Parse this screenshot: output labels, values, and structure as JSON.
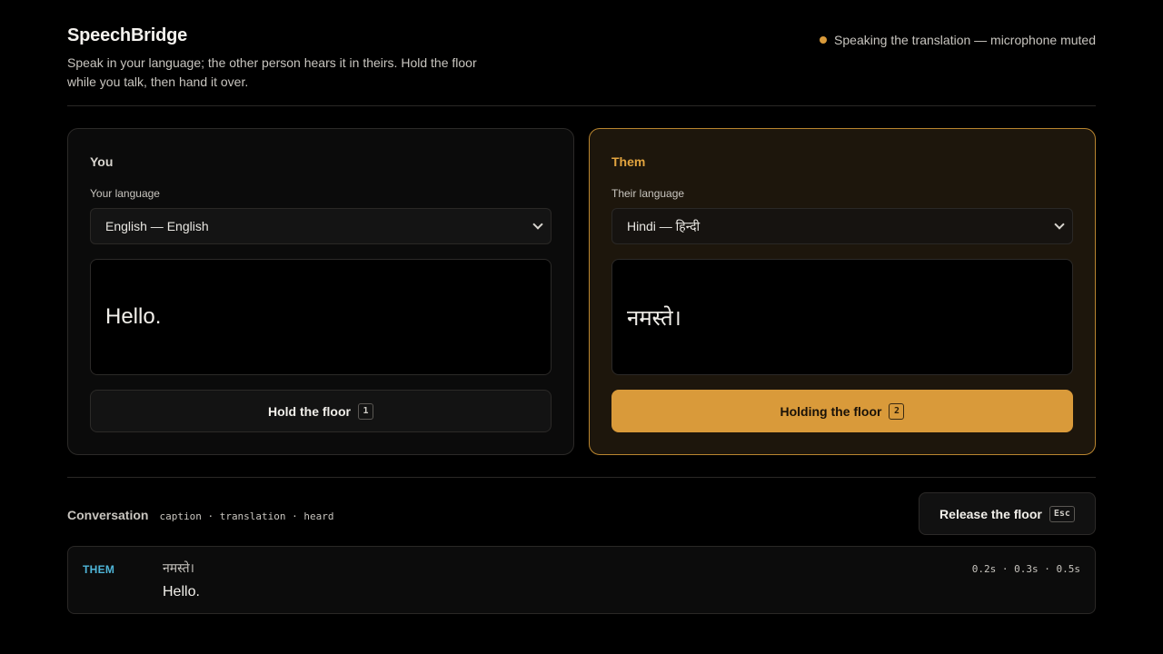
{
  "app": {
    "title": "SpeechBridge",
    "subtitle": "Speak in your language; the other person hears it in theirs. Hold the floor while you talk, then hand it over.",
    "status": "Speaking the translation — microphone muted",
    "status_color": "#d99a3a"
  },
  "you": {
    "label": "You",
    "language_label": "Your language",
    "language_value": "English — English",
    "caption": "Hello.",
    "button_label": "Hold the floor",
    "button_key": "1"
  },
  "them": {
    "label": "Them",
    "language_label": "Their language",
    "language_value": "Hindi — हिन्दी",
    "caption": "नमस्ते।",
    "button_label": "Holding the floor",
    "button_key": "2",
    "accent_color": "#d99a3a"
  },
  "conversation": {
    "title": "Conversation",
    "legend": "caption · translation · heard",
    "release_label": "Release the floor",
    "release_key": "Esc",
    "turns": [
      {
        "speaker": "THEM",
        "caption": "नमस्ते।",
        "translation": "Hello.",
        "timing": "0.2s · 0.3s · 0.5s"
      }
    ]
  }
}
